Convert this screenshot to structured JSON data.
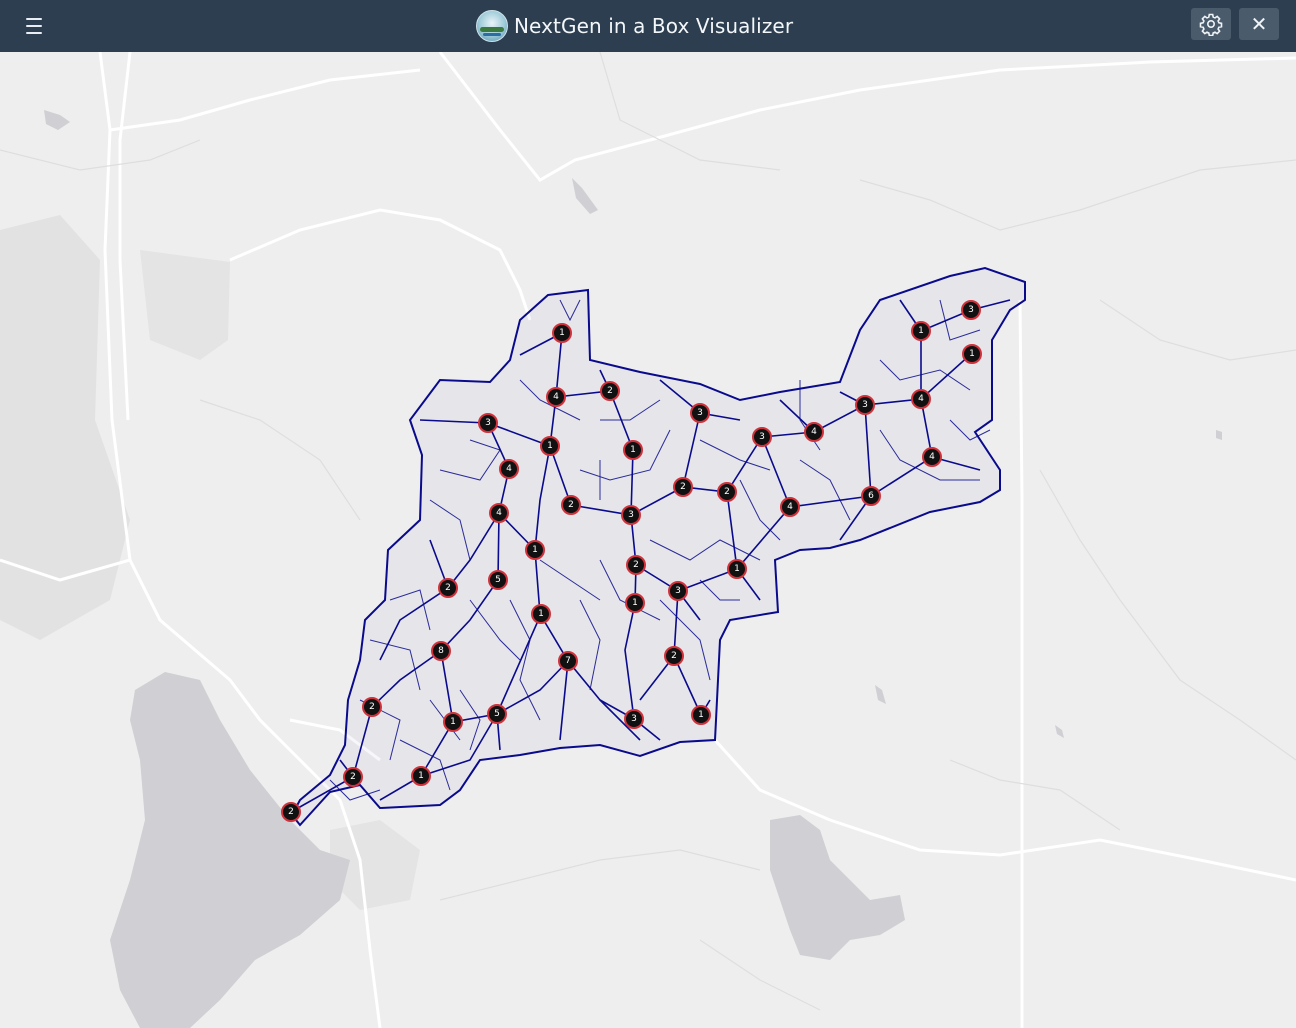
{
  "header": {
    "title": "NextGen in a Box Visualizer",
    "menu_icon": "hamburger-menu-icon",
    "settings_icon": "gear-icon",
    "close_icon": "close-icon",
    "close_glyph": "✕"
  },
  "colors": {
    "header_bg": "#2c3e50",
    "header_button_bg": "#4a5b6c",
    "map_bg": "#eeeeee",
    "water": "#cfcfd4",
    "roads": "#ffffff",
    "basin_lines": "#0a0a8c",
    "marker_fill": "#111111",
    "marker_ring": "#d0323c"
  },
  "map": {
    "markers": [
      "1",
      "2",
      "4",
      "3",
      "3",
      "3",
      "4",
      "3",
      "1",
      "3",
      "1",
      "4",
      "1",
      "2",
      "4",
      "4",
      "2",
      "2",
      "3",
      "2",
      "4",
      "6",
      "4",
      "1",
      "5",
      "2",
      "2",
      "1",
      "3",
      "1",
      "8",
      "7",
      "2",
      "2",
      "1",
      "5",
      "3",
      "1",
      "2",
      "1",
      "2"
    ]
  }
}
